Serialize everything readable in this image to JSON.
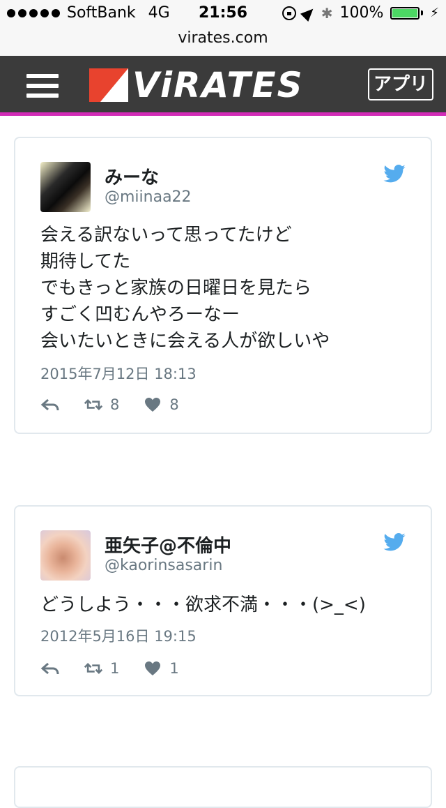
{
  "status_bar": {
    "carrier": "SoftBank",
    "network": "4G",
    "time": "21:56",
    "battery": "100%",
    "url": "virates.com"
  },
  "header": {
    "logo_text": "ViRATES",
    "app_button": "アプリ",
    "accent_color": "#d22bb7",
    "logo_color": "#e8432e"
  },
  "tweets": [
    {
      "name": "みーな",
      "handle": "@miinaa22",
      "text": "会える訳ないって思ってたけど\n期待してた\nでもきっと家族の日曜日を見たら\nすごく凹むんやろーなー\n会いたいときに会える人が欲しいや",
      "date": "2015年7月12日 18:13",
      "retweets": "8",
      "likes": "8"
    },
    {
      "name": "亜矢子@不倫中",
      "handle": "@kaorinsasarin",
      "text": "どうしよう・・・欲求不満・・・(>_<)",
      "date": "2012年5月16日 19:15",
      "retweets": "1",
      "likes": "1"
    }
  ],
  "icons": {
    "twitter": "twitter-bird-icon",
    "reply": "reply-icon",
    "retweet": "retweet-icon",
    "like": "heart-icon"
  }
}
